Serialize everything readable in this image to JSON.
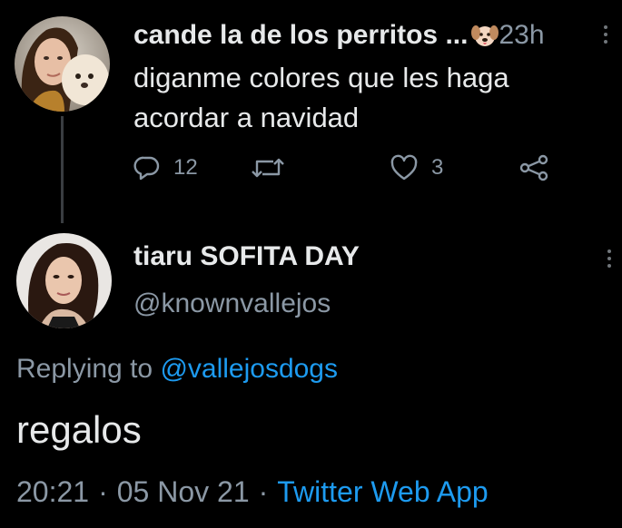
{
  "colors": {
    "background": "#000000",
    "primary_text": "#e7e9ea",
    "secondary_text": "#8b98a5",
    "link": "#1d9bf0"
  },
  "tweet": {
    "display_name": "cande la de los perritos ...",
    "name_emoji": "dog-face-emoji",
    "time_ago": "23h",
    "text_line1": "diganme colores que les haga",
    "text_line2": "acordar a navidad",
    "reply_count": "12",
    "like_count": "3",
    "icons": [
      "reply-icon",
      "retweet-icon",
      "like-icon",
      "share-icon",
      "more-options-icon"
    ]
  },
  "reply": {
    "display_name": "tiaru SOFITA DAY",
    "handle": "@knownvallejos",
    "replying_prefix": "Replying to ",
    "replying_mention": "@vallejosdogs",
    "text": "regalos",
    "time": "20:21",
    "date": "05 Nov 21",
    "source": "Twitter Web App",
    "separator": "·"
  }
}
